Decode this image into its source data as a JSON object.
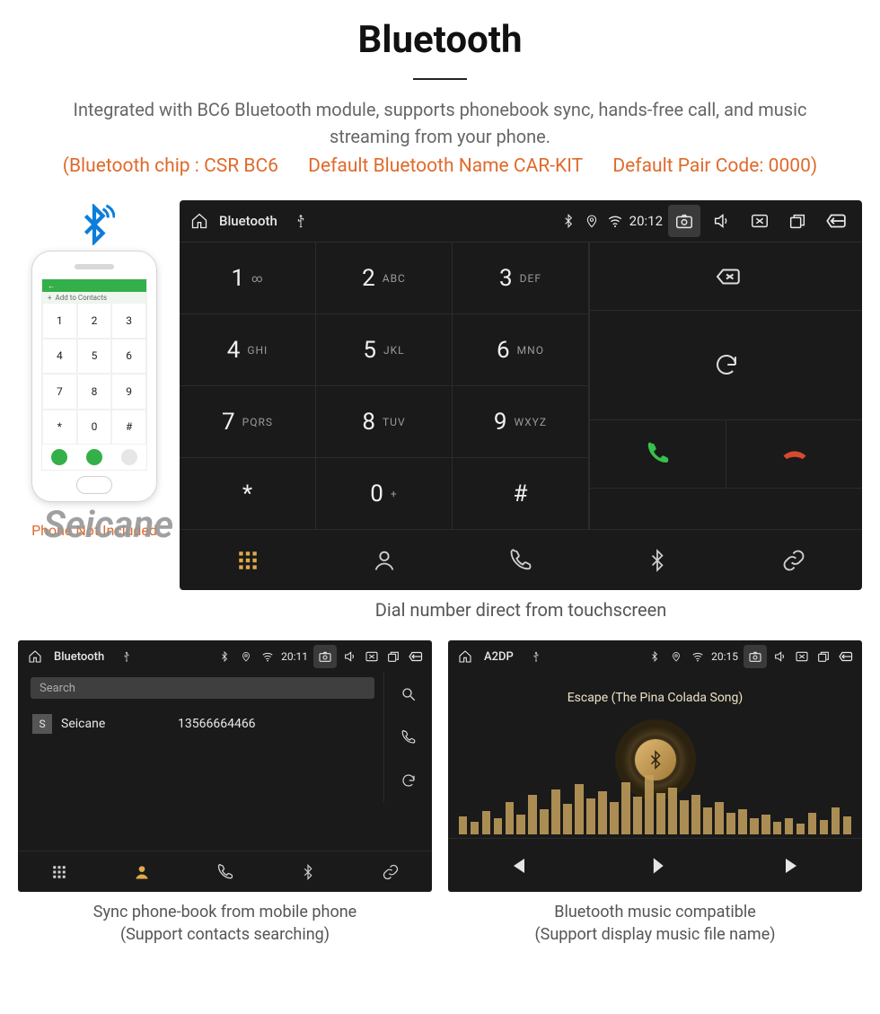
{
  "title": "Bluetooth",
  "description": "Integrated with BC6 Bluetooth module, supports phonebook sync, hands-free call, and music streaming from your phone.",
  "spec": {
    "chip": "(Bluetooth chip : CSR BC6",
    "name": "Default Bluetooth Name CAR-KIT",
    "pair": "Default Pair Code: 0000)"
  },
  "watermark": "Seicane",
  "phone_note": "Phone Not Included",
  "phone_ui": {
    "add_contacts": "Add to Contacts",
    "keys": [
      "1",
      "2",
      "3",
      "4",
      "5",
      "6",
      "7",
      "8",
      "9",
      "*",
      "0",
      "#"
    ]
  },
  "dialer": {
    "status": {
      "title": "Bluetooth",
      "time": "20:12"
    },
    "keys": [
      {
        "d": "1",
        "s": "∞"
      },
      {
        "d": "2",
        "s": "ABC"
      },
      {
        "d": "3",
        "s": "DEF"
      },
      {
        "d": "4",
        "s": "GHI"
      },
      {
        "d": "5",
        "s": "JKL"
      },
      {
        "d": "6",
        "s": "MNO"
      },
      {
        "d": "7",
        "s": "PQRS"
      },
      {
        "d": "8",
        "s": "TUV"
      },
      {
        "d": "9",
        "s": "WXYZ"
      },
      {
        "d": "*",
        "s": ""
      },
      {
        "d": "0",
        "s": "+"
      },
      {
        "d": "#",
        "s": ""
      }
    ],
    "caption": "Dial number direct from touchscreen"
  },
  "contacts": {
    "status": {
      "title": "Bluetooth",
      "time": "20:11"
    },
    "search_placeholder": "Search",
    "rows": [
      {
        "letter": "S",
        "name": "Seicane",
        "number": "13566664466"
      }
    ],
    "caption1": "Sync phone-book from mobile phone",
    "caption2": "(Support contacts searching)"
  },
  "music": {
    "status": {
      "title": "A2DP",
      "time": "20:15"
    },
    "song": "Escape (The Pina Colada Song)",
    "eq": [
      20,
      14,
      26,
      18,
      36,
      22,
      44,
      28,
      50,
      34,
      56,
      40,
      48,
      36,
      58,
      42,
      66,
      46,
      52,
      38,
      44,
      30,
      36,
      24,
      28,
      18,
      22,
      14,
      18,
      12,
      24,
      16,
      30,
      20
    ],
    "caption1": "Bluetooth music compatible",
    "caption2": "(Support display music file name)"
  }
}
